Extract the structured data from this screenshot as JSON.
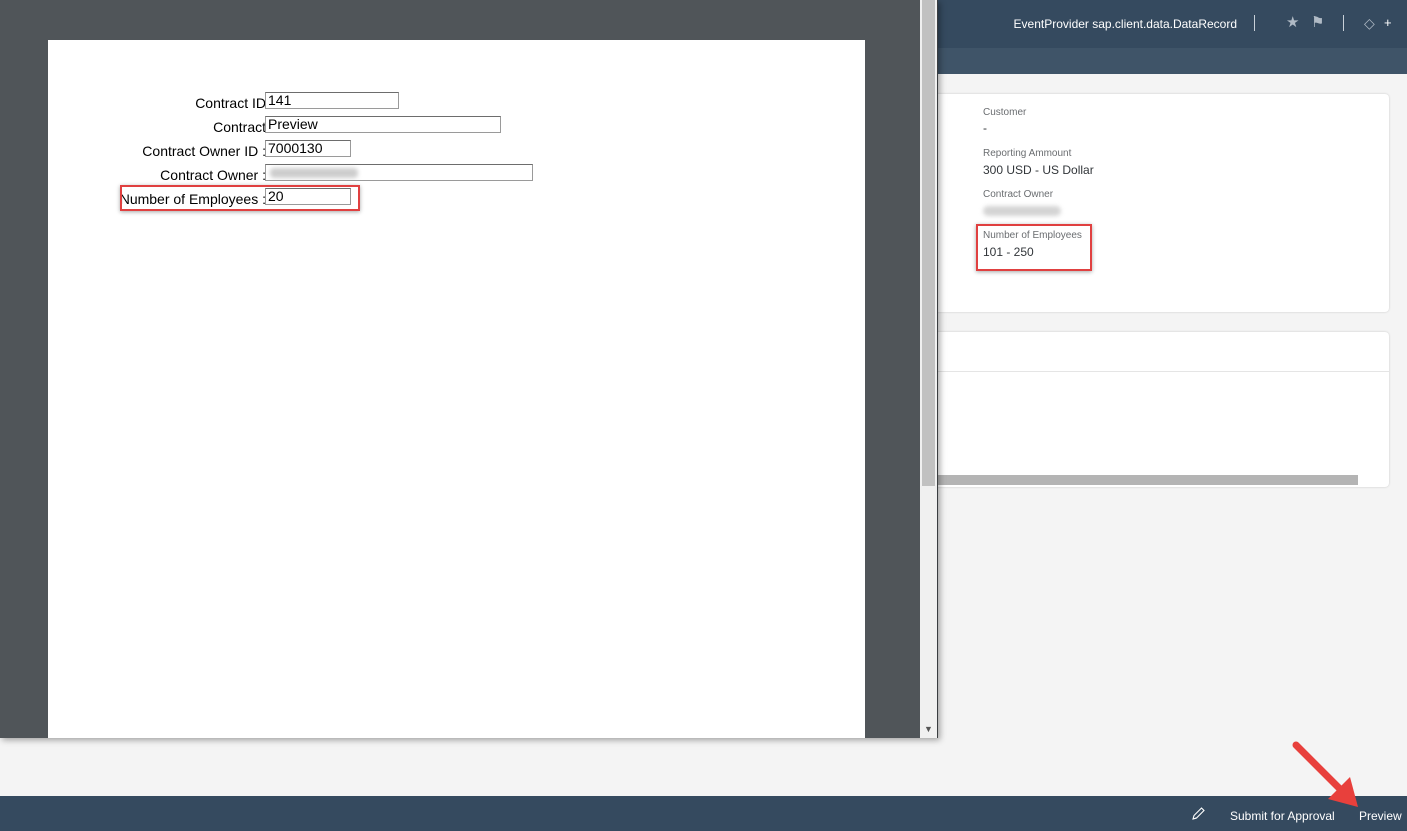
{
  "shell": {
    "title": "EventProvider sap.client.data.DataRecord",
    "separator": "|",
    "icons": [
      "star-icon",
      "flag-icon",
      "share-icon",
      "add-icon"
    ]
  },
  "details": {
    "customer_label": "Customer",
    "customer_value": "-",
    "reporting_label": "Reporting Ammount",
    "reporting_value": "300 USD - US Dollar",
    "owner_label": "Contract Owner",
    "employees_label": "Number of Employees",
    "employees_value": "101 - 250"
  },
  "preview": {
    "contract_id_label": "Contract ID",
    "contract_id_value": "141",
    "contract_label": "Contract",
    "contract_value": "Preview",
    "owner_id_label": "Contract Owner ID  :",
    "owner_id_value": "7000130",
    "owner_label": "Contract Owner  :",
    "employees_label": "Number of Employees :",
    "employees_value": "20"
  },
  "footer": {
    "submit_label": "Submit for Approval",
    "preview_label": "Preview"
  },
  "colors": {
    "shell": "#354a5f",
    "highlight": "#e04040",
    "arrow": "#e8403c"
  }
}
